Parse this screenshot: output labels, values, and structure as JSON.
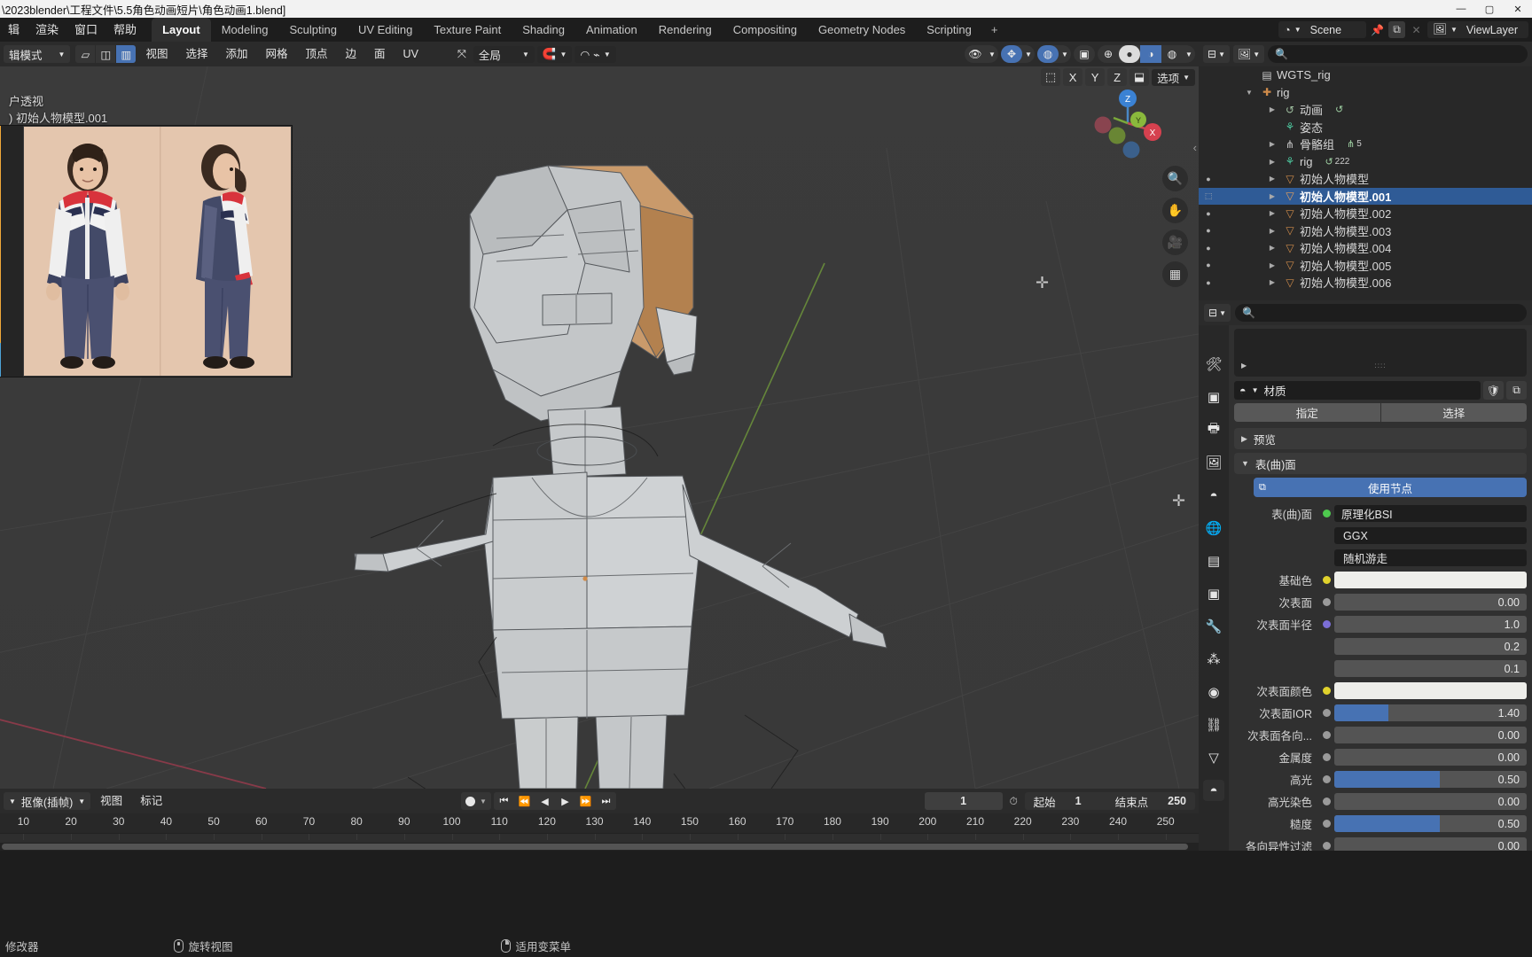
{
  "window": {
    "title": "\\2023blender\\工程文件\\5.5角色动画短片\\角色动画1.blend]",
    "minimize": "—",
    "maximize": "▢",
    "close": "✕"
  },
  "topbar": {
    "menus": [
      "辑",
      "渲染",
      "窗口",
      "帮助"
    ],
    "workspaces": [
      {
        "label": "Layout",
        "active": true
      },
      {
        "label": "Modeling",
        "active": false
      },
      {
        "label": "Sculpting",
        "active": false
      },
      {
        "label": "UV Editing",
        "active": false
      },
      {
        "label": "Texture Paint",
        "active": false
      },
      {
        "label": "Shading",
        "active": false
      },
      {
        "label": "Animation",
        "active": false
      },
      {
        "label": "Rendering",
        "active": false
      },
      {
        "label": "Compositing",
        "active": false
      },
      {
        "label": "Geometry Nodes",
        "active": false
      },
      {
        "label": "Scripting",
        "active": false
      }
    ],
    "add_workspace": "+",
    "scene_name": "Scene",
    "viewlayer_name": "ViewLayer"
  },
  "viewport": {
    "mode": "辑模式",
    "menus": [
      "视图",
      "选择",
      "添加",
      "网格",
      "顶点",
      "边",
      "面",
      "UV"
    ],
    "transform_orientation": "全局",
    "options_label": "选项",
    "overlay_line1": "户透视",
    "overlay_line2": ") 初始人物模型.001",
    "gizmo_axes": [
      "Z",
      "Y",
      "X"
    ]
  },
  "timeline": {
    "editor_mode": "抠像(插帧)",
    "menus": [
      "视图",
      "标记"
    ],
    "current_frame": "1",
    "start_label": "起始",
    "start_frame": "1",
    "end_label": "结束点",
    "end_frame": "250",
    "ticks": [
      10,
      20,
      30,
      40,
      50,
      60,
      70,
      80,
      90,
      100,
      110,
      120,
      130,
      140,
      150,
      160,
      170,
      180,
      190,
      200,
      210,
      220,
      230,
      240,
      250
    ],
    "transport": [
      "⏮",
      "⏪",
      "◀",
      "▶",
      "⏩",
      "⏭"
    ]
  },
  "outliner": {
    "search_placeholder": "",
    "rows": [
      {
        "indent": 1,
        "arrow": "",
        "icon": "collection-icon",
        "glyph": "▤",
        "color": "#c8c8c8",
        "label": "WGTS_rig",
        "extra": "",
        "count": ""
      },
      {
        "indent": 1,
        "arrow": "▼",
        "icon": "armature-icon",
        "glyph": "✚",
        "color": "#d08b4a",
        "label": "rig",
        "extra": "",
        "count": ""
      },
      {
        "indent": 2,
        "arrow": "▶",
        "icon": "action-icon",
        "glyph": "↺",
        "color": "#9fbf9f",
        "label": "动画",
        "extra": "↺",
        "count": ""
      },
      {
        "indent": 2,
        "arrow": "",
        "icon": "pose-icon",
        "glyph": "⚘",
        "color": "#4ec9a0",
        "label": "姿态",
        "extra": "",
        "count": ""
      },
      {
        "indent": 2,
        "arrow": "▶",
        "icon": "bonegroup-icon",
        "glyph": "⋔",
        "color": "#c9c9c9",
        "label": "骨骼组",
        "extra": "⋔",
        "count": "5"
      },
      {
        "indent": 2,
        "arrow": "▶",
        "icon": "armature-data-icon",
        "glyph": "⚘",
        "color": "#4ec9a0",
        "label": "rig",
        "extra": "↺",
        "count": "222"
      },
      {
        "indent": 2,
        "arrow": "▶",
        "icon": "mesh-icon",
        "glyph": "▽",
        "color": "#d08b4a",
        "label": "初始人物模型",
        "extra": "",
        "count": "",
        "dot": true
      },
      {
        "indent": 2,
        "arrow": "▶",
        "icon": "mesh-icon",
        "glyph": "▽",
        "color": "#e6a05c",
        "label": "初始人物模型.001",
        "extra": "",
        "count": "",
        "selected": true
      },
      {
        "indent": 2,
        "arrow": "▶",
        "icon": "mesh-icon",
        "glyph": "▽",
        "color": "#d08b4a",
        "label": "初始人物模型.002",
        "extra": "",
        "count": "",
        "dot": true
      },
      {
        "indent": 2,
        "arrow": "▶",
        "icon": "mesh-icon",
        "glyph": "▽",
        "color": "#d08b4a",
        "label": "初始人物模型.003",
        "extra": "",
        "count": "",
        "dot": true
      },
      {
        "indent": 2,
        "arrow": "▶",
        "icon": "mesh-icon",
        "glyph": "▽",
        "color": "#d08b4a",
        "label": "初始人物模型.004",
        "extra": "",
        "count": "",
        "dot": true
      },
      {
        "indent": 2,
        "arrow": "▶",
        "icon": "mesh-icon",
        "glyph": "▽",
        "color": "#d08b4a",
        "label": "初始人物模型.005",
        "extra": "",
        "count": "",
        "dot": true
      },
      {
        "indent": 2,
        "arrow": "▶",
        "icon": "mesh-icon",
        "glyph": "▽",
        "color": "#d08b4a",
        "label": "初始人物模型.006",
        "extra": "",
        "count": "",
        "dot": true
      }
    ]
  },
  "properties": {
    "search_placeholder": "",
    "material_name": "材质",
    "assign_label": "指定",
    "select_label": "选择",
    "preview_label": "预览",
    "surface_panel_label": "表(曲)面",
    "use_nodes_label": "使用节点",
    "surface_row_label": "表(曲)面",
    "shader_name": "原理化BSI",
    "distribution": "GGX",
    "subsurface_method": "随机游走",
    "rows": [
      {
        "label": "基础色",
        "type": "swatch",
        "value": "",
        "dot": "#e0d22c"
      },
      {
        "label": "次表面",
        "type": "num",
        "value": "0.00",
        "dot": "#9a9a9a",
        "fill": 0
      },
      {
        "label": "次表面半径",
        "type": "num",
        "value": "1.0",
        "dot": "#7b6ed6",
        "fill": 0
      },
      {
        "label": "",
        "type": "num",
        "value": "0.2",
        "dot": "",
        "fill": 0,
        "sub": true
      },
      {
        "label": "",
        "type": "num",
        "value": "0.1",
        "dot": "",
        "fill": 0,
        "sub": true
      },
      {
        "label": "次表面颜色",
        "type": "swatch",
        "value": "",
        "dot": "#e0d22c"
      },
      {
        "label": "次表面IOR",
        "type": "num",
        "value": "1.40",
        "dot": "#9a9a9a",
        "fill": 28
      },
      {
        "label": "次表面各向...",
        "type": "num",
        "value": "0.00",
        "dot": "#9a9a9a",
        "fill": 0
      },
      {
        "label": "金属度",
        "type": "num",
        "value": "0.00",
        "dot": "#9a9a9a",
        "fill": 0
      },
      {
        "label": "高光",
        "type": "num",
        "value": "0.50",
        "dot": "#9a9a9a",
        "fill": 55
      },
      {
        "label": "高光染色",
        "type": "num",
        "value": "0.00",
        "dot": "#9a9a9a",
        "fill": 0
      },
      {
        "label": "糙度",
        "type": "num",
        "value": "0.50",
        "dot": "#9a9a9a",
        "fill": 55
      },
      {
        "label": "各向异性过滤",
        "type": "num",
        "value": "0.00",
        "dot": "#9a9a9a",
        "fill": 0
      }
    ],
    "tabs": [
      {
        "name": "tool-tab",
        "glyph": "🛠",
        "active": false
      },
      {
        "name": "render-tab",
        "glyph": "▣",
        "active": false
      },
      {
        "name": "output-tab",
        "glyph": "🖶",
        "active": false
      },
      {
        "name": "viewlayer-tab",
        "glyph": "🖼",
        "active": false
      },
      {
        "name": "scene-tab",
        "glyph": "◓",
        "active": false
      },
      {
        "name": "world-tab",
        "glyph": "🌐",
        "active": false
      },
      {
        "name": "collection-tab",
        "glyph": "▤",
        "active": false
      },
      {
        "name": "object-tab",
        "glyph": "▣",
        "active": false
      },
      {
        "name": "modifier-tab",
        "glyph": "🔧",
        "active": false
      },
      {
        "name": "particles-tab",
        "glyph": "⁂",
        "active": false
      },
      {
        "name": "physics-tab",
        "glyph": "◉",
        "active": false
      },
      {
        "name": "constraint-tab",
        "glyph": "⛓",
        "active": false
      },
      {
        "name": "data-tab",
        "glyph": "▽",
        "active": false
      },
      {
        "name": "material-tab",
        "glyph": "◓",
        "active": true
      }
    ]
  },
  "statusbar": {
    "items": [
      "修改器",
      "旋转视图",
      "适用变菜单"
    ]
  },
  "colors": {
    "accent_blue": "#4772b3",
    "selection_blue": "#2f5b96",
    "panel_bg": "#303030",
    "viewport_bg": "#3b3b3b",
    "mesh_orange": "#d08b4a"
  }
}
